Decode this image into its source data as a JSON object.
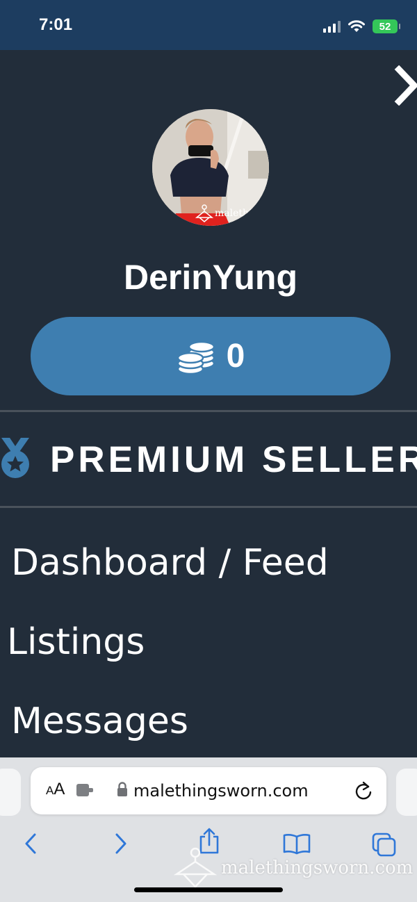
{
  "status_bar": {
    "time": "7:01",
    "battery": "52"
  },
  "profile": {
    "username": "DerinYung",
    "avatar_watermark": "malethin"
  },
  "coins": {
    "value": "0",
    "icon": "coins-icon"
  },
  "badge": {
    "label": "PREMIUM SELLER",
    "icon": "medal-icon"
  },
  "menu": {
    "items": [
      {
        "label": "Dashboard / Feed"
      },
      {
        "label": "Listings"
      },
      {
        "label": "Messages"
      }
    ]
  },
  "browser": {
    "aa_small": "A",
    "aa_big": "A",
    "url": "malethingsworn.com"
  },
  "watermark": {
    "text": "malethingsworn.com"
  },
  "colors": {
    "background": "#222d3a",
    "status_bar": "#1d3d60",
    "coins_button": "#3e7eb0",
    "accent_blue": "#2f77d8",
    "battery_green": "#34c759"
  }
}
